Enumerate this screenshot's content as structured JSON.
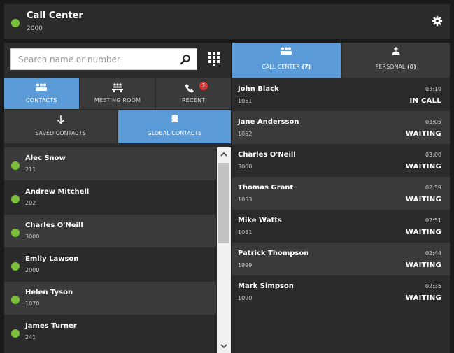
{
  "header": {
    "title": "Call Center",
    "subtitle": "2000",
    "status_color": "#7cbf3a"
  },
  "search": {
    "placeholder": "Search name or number"
  },
  "tabs": [
    {
      "label": "Contacts",
      "icon": "group-icon",
      "active": true
    },
    {
      "label": "Meeting Room",
      "icon": "meeting-room-icon",
      "active": false
    },
    {
      "label": "Recent",
      "icon": "recent-calls-icon",
      "active": false,
      "badge": "1"
    }
  ],
  "subtabs": [
    {
      "label": "Saved Contacts",
      "icon": "arrow-down-icon",
      "active": false
    },
    {
      "label": "Global Contacts",
      "icon": "database-icon",
      "active": true
    }
  ],
  "contacts": [
    {
      "name": "Alec Snow",
      "number": "211"
    },
    {
      "name": "Andrew Mitchell",
      "number": "202"
    },
    {
      "name": "Charles O'Neill",
      "number": "3000"
    },
    {
      "name": "Emily Lawson",
      "number": "2000"
    },
    {
      "name": "Helen Tyson",
      "number": "1070"
    },
    {
      "name": "James Turner",
      "number": "241"
    }
  ],
  "right_tabs": [
    {
      "label": "CALL CENTER",
      "count": "(7)",
      "icon": "group-icon",
      "active": true
    },
    {
      "label": "PERSONAL",
      "count": "(0)",
      "icon": "person-icon",
      "active": false
    }
  ],
  "queue": [
    {
      "name": "John Black",
      "number": "1051",
      "time": "03:10",
      "status": "IN CALL"
    },
    {
      "name": "Jane Andersson",
      "number": "1052",
      "time": "03:05",
      "status": "WAITING"
    },
    {
      "name": "Charles O'Neill",
      "number": "3000",
      "time": "03:00",
      "status": "WAITING"
    },
    {
      "name": "Thomas Grant",
      "number": "1053",
      "time": "02:59",
      "status": "WAITING"
    },
    {
      "name": "Mike Watts",
      "number": "1081",
      "time": "02:51",
      "status": "WAITING"
    },
    {
      "name": "Patrick Thompson",
      "number": "1999",
      "time": "02:44",
      "status": "WAITING"
    },
    {
      "name": "Mark Simpson",
      "number": "1090",
      "time": "02:35",
      "status": "WAITING"
    }
  ],
  "colors": {
    "accent": "#5a9bd8",
    "online": "#7cbf3a",
    "badge": "#e0322b"
  }
}
